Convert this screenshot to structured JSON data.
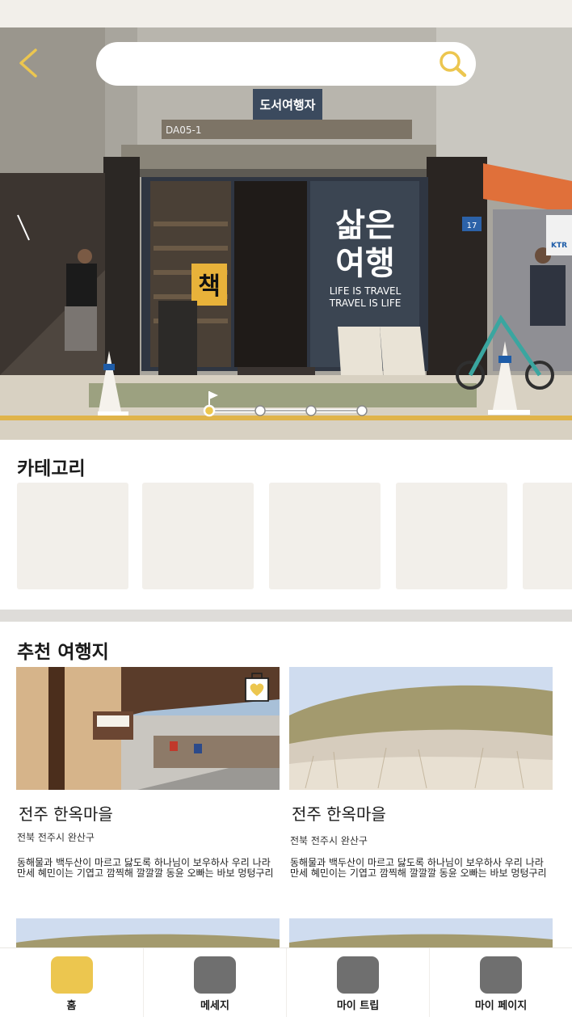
{
  "search": {
    "placeholder": "",
    "value": ""
  },
  "icons": {
    "back": "chevron-left-icon",
    "search": "search-icon",
    "favorite": "heart-bookmark-icon"
  },
  "colors": {
    "accent": "#ecc64f",
    "tile": "#f2efea",
    "nav_inactive": "#6f6f6f",
    "divider": "#dedcd9"
  },
  "hero": {
    "signboard": "도서여행자",
    "store_code": "DA05-1",
    "window_big": "삶은\n여행",
    "window_line1": "LIFE IS TRAVEL",
    "window_line2": "TRAVEL IS LIFE",
    "poster_char": "책",
    "pole_number": "17",
    "right_sign": "KTR",
    "slide_count": 4,
    "active_slide": 1
  },
  "category": {
    "title": "카테고리",
    "tiles": [
      "",
      "",
      "",
      "",
      ""
    ]
  },
  "recommend": {
    "title": "추천 여행지",
    "cards": [
      {
        "name": "전주 한옥마을",
        "region": "전북 전주시 완산구",
        "desc": "동해물과 백두산이 마르고 닳도록 하나님이 보우하사 우리 나라만세 혜민이는 기엽고 깜찍해 깔깔깔 동윤 오빠는 바보 멍텅구리"
      },
      {
        "name": "전주 한옥마을",
        "region": "전북 전주시 완산구",
        "desc": "동해물과 백두산이 마르고 닳도록 하나님이 보우하사 우리 나라만세 혜민이는 기엽고 깜찍해 깔깔깔 동윤 오빠는 바보 멍텅구리"
      }
    ]
  },
  "nav": {
    "items": [
      {
        "label": "홈",
        "active": true
      },
      {
        "label": "메세지",
        "active": false
      },
      {
        "label": "마이 트립",
        "active": false
      },
      {
        "label": "마이 페이지",
        "active": false
      }
    ]
  }
}
